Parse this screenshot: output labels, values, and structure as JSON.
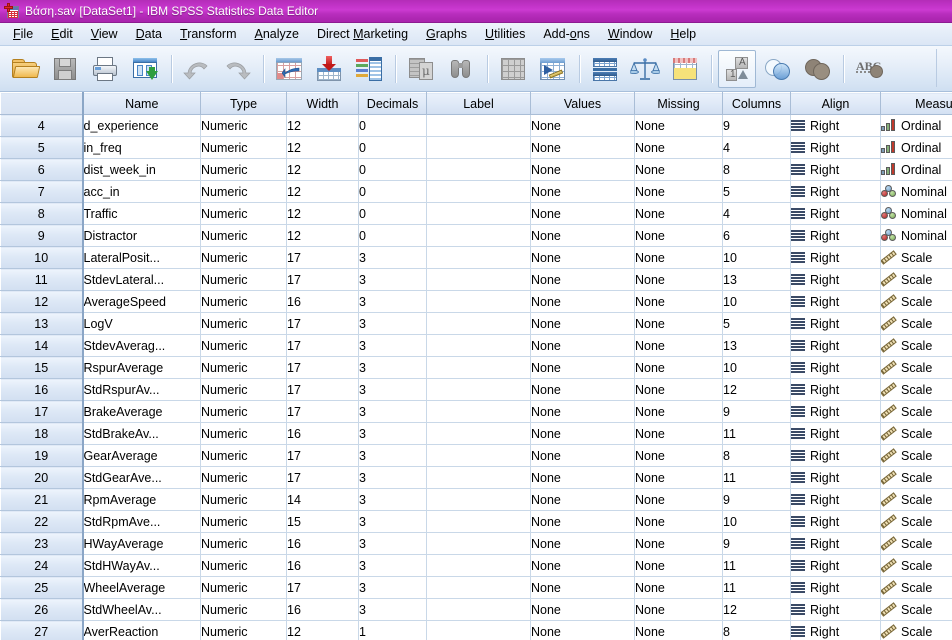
{
  "window": {
    "title": "Βάση.sav [DataSet1] - IBM SPSS Statistics Data Editor",
    "icon": "spss-data-editor-icon",
    "titlebar_color": "#c334c9"
  },
  "menu": {
    "items": [
      {
        "label": "File",
        "accel": "F"
      },
      {
        "label": "Edit",
        "accel": "E"
      },
      {
        "label": "View",
        "accel": "V"
      },
      {
        "label": "Data",
        "accel": "D"
      },
      {
        "label": "Transform",
        "accel": "T"
      },
      {
        "label": "Analyze",
        "accel": "A"
      },
      {
        "label": "Direct Marketing",
        "accel": "M"
      },
      {
        "label": "Graphs",
        "accel": "G"
      },
      {
        "label": "Utilities",
        "accel": "U"
      },
      {
        "label": "Add-ons",
        "accel": "o"
      },
      {
        "label": "Window",
        "accel": "W"
      },
      {
        "label": "Help",
        "accel": "H"
      }
    ]
  },
  "toolbar": {
    "buttons": [
      {
        "name": "open-file-button",
        "icon": "open-folder-icon",
        "enabled": true,
        "active": false
      },
      {
        "name": "save-file-button",
        "icon": "floppy-disk-icon",
        "enabled": false,
        "active": false
      },
      {
        "name": "print-button",
        "icon": "printer-icon",
        "enabled": true,
        "active": false
      },
      {
        "name": "recall-dialogs-button",
        "icon": "recall-dialogs-icon",
        "enabled": true,
        "active": false
      },
      {
        "name": "undo-button",
        "icon": "undo-arrow-icon",
        "enabled": false,
        "active": false
      },
      {
        "name": "redo-button",
        "icon": "redo-arrow-icon",
        "enabled": false,
        "active": false
      },
      {
        "name": "goto-case-button",
        "icon": "goto-case-icon",
        "enabled": true,
        "active": false
      },
      {
        "name": "goto-variable-button",
        "icon": "goto-variable-icon",
        "enabled": true,
        "active": false
      },
      {
        "name": "variables-button",
        "icon": "variables-list-icon",
        "enabled": true,
        "active": false
      },
      {
        "name": "run-descriptives-button",
        "icon": "descriptives-icon",
        "enabled": false,
        "active": false
      },
      {
        "name": "find-button",
        "icon": "binoculars-icon",
        "enabled": false,
        "active": false
      },
      {
        "name": "insert-case-button",
        "icon": "insert-case-icon",
        "enabled": false,
        "active": false
      },
      {
        "name": "insert-variable-button",
        "icon": "insert-variable-icon",
        "enabled": true,
        "active": false
      },
      {
        "name": "split-file-button",
        "icon": "split-file-icon",
        "enabled": true,
        "active": false
      },
      {
        "name": "weight-cases-button",
        "icon": "balance-scale-icon",
        "enabled": true,
        "active": false
      },
      {
        "name": "select-cases-button",
        "icon": "select-cases-icon",
        "enabled": true,
        "active": false
      },
      {
        "name": "value-labels-button",
        "icon": "value-labels-icon",
        "enabled": true,
        "active": true
      },
      {
        "name": "use-sets-button",
        "icon": "use-sets-venn-icon",
        "enabled": true,
        "active": false
      },
      {
        "name": "show-all-variables-button",
        "icon": "show-all-variables-icon",
        "enabled": false,
        "active": false
      },
      {
        "name": "spell-check-button",
        "icon": "spell-check-abc-icon",
        "enabled": false,
        "active": false
      }
    ]
  },
  "grid": {
    "columns": [
      "Name",
      "Type",
      "Width",
      "Decimals",
      "Label",
      "Values",
      "Missing",
      "Columns",
      "Align",
      "Measure"
    ],
    "rows": [
      {
        "n": "4",
        "name": "d_experience",
        "type": "Numeric",
        "width": "12",
        "decimals": "0",
        "label": "",
        "values": "None",
        "missing": "None",
        "columns": "9",
        "align": "Right",
        "measure": "Ordinal"
      },
      {
        "n": "5",
        "name": "in_freq",
        "type": "Numeric",
        "width": "12",
        "decimals": "0",
        "label": "",
        "values": "None",
        "missing": "None",
        "columns": "4",
        "align": "Right",
        "measure": "Ordinal"
      },
      {
        "n": "6",
        "name": "dist_week_in",
        "type": "Numeric",
        "width": "12",
        "decimals": "0",
        "label": "",
        "values": "None",
        "missing": "None",
        "columns": "8",
        "align": "Right",
        "measure": "Ordinal"
      },
      {
        "n": "7",
        "name": "acc_in",
        "type": "Numeric",
        "width": "12",
        "decimals": "0",
        "label": "",
        "values": "None",
        "missing": "None",
        "columns": "5",
        "align": "Right",
        "measure": "Nominal"
      },
      {
        "n": "8",
        "name": "Traffic",
        "type": "Numeric",
        "width": "12",
        "decimals": "0",
        "label": "",
        "values": "None",
        "missing": "None",
        "columns": "4",
        "align": "Right",
        "measure": "Nominal"
      },
      {
        "n": "9",
        "name": "Distractor",
        "type": "Numeric",
        "width": "12",
        "decimals": "0",
        "label": "",
        "values": "None",
        "missing": "None",
        "columns": "6",
        "align": "Right",
        "measure": "Nominal"
      },
      {
        "n": "10",
        "name": "LateralPosit...",
        "type": "Numeric",
        "width": "17",
        "decimals": "3",
        "label": "",
        "values": "None",
        "missing": "None",
        "columns": "10",
        "align": "Right",
        "measure": "Scale"
      },
      {
        "n": "11",
        "name": "StdevLateral...",
        "type": "Numeric",
        "width": "17",
        "decimals": "3",
        "label": "",
        "values": "None",
        "missing": "None",
        "columns": "13",
        "align": "Right",
        "measure": "Scale"
      },
      {
        "n": "12",
        "name": "AverageSpeed",
        "type": "Numeric",
        "width": "16",
        "decimals": "3",
        "label": "",
        "values": "None",
        "missing": "None",
        "columns": "10",
        "align": "Right",
        "measure": "Scale"
      },
      {
        "n": "13",
        "name": "LogV",
        "type": "Numeric",
        "width": "17",
        "decimals": "3",
        "label": "",
        "values": "None",
        "missing": "None",
        "columns": "5",
        "align": "Right",
        "measure": "Scale"
      },
      {
        "n": "14",
        "name": "StdevAverag...",
        "type": "Numeric",
        "width": "17",
        "decimals": "3",
        "label": "",
        "values": "None",
        "missing": "None",
        "columns": "13",
        "align": "Right",
        "measure": "Scale"
      },
      {
        "n": "15",
        "name": "RspurAverage",
        "type": "Numeric",
        "width": "17",
        "decimals": "3",
        "label": "",
        "values": "None",
        "missing": "None",
        "columns": "10",
        "align": "Right",
        "measure": "Scale"
      },
      {
        "n": "16",
        "name": "StdRspurAv...",
        "type": "Numeric",
        "width": "17",
        "decimals": "3",
        "label": "",
        "values": "None",
        "missing": "None",
        "columns": "12",
        "align": "Right",
        "measure": "Scale"
      },
      {
        "n": "17",
        "name": "BrakeAverage",
        "type": "Numeric",
        "width": "17",
        "decimals": "3",
        "label": "",
        "values": "None",
        "missing": "None",
        "columns": "9",
        "align": "Right",
        "measure": "Scale"
      },
      {
        "n": "18",
        "name": "StdBrakeAv...",
        "type": "Numeric",
        "width": "16",
        "decimals": "3",
        "label": "",
        "values": "None",
        "missing": "None",
        "columns": "11",
        "align": "Right",
        "measure": "Scale"
      },
      {
        "n": "19",
        "name": "GearAverage",
        "type": "Numeric",
        "width": "17",
        "decimals": "3",
        "label": "",
        "values": "None",
        "missing": "None",
        "columns": "8",
        "align": "Right",
        "measure": "Scale"
      },
      {
        "n": "20",
        "name": "StdGearAve...",
        "type": "Numeric",
        "width": "17",
        "decimals": "3",
        "label": "",
        "values": "None",
        "missing": "None",
        "columns": "11",
        "align": "Right",
        "measure": "Scale"
      },
      {
        "n": "21",
        "name": "RpmAverage",
        "type": "Numeric",
        "width": "14",
        "decimals": "3",
        "label": "",
        "values": "None",
        "missing": "None",
        "columns": "9",
        "align": "Right",
        "measure": "Scale"
      },
      {
        "n": "22",
        "name": "StdRpmAve...",
        "type": "Numeric",
        "width": "15",
        "decimals": "3",
        "label": "",
        "values": "None",
        "missing": "None",
        "columns": "10",
        "align": "Right",
        "measure": "Scale"
      },
      {
        "n": "23",
        "name": "HWayAverage",
        "type": "Numeric",
        "width": "16",
        "decimals": "3",
        "label": "",
        "values": "None",
        "missing": "None",
        "columns": "9",
        "align": "Right",
        "measure": "Scale"
      },
      {
        "n": "24",
        "name": "StdHWayAv...",
        "type": "Numeric",
        "width": "16",
        "decimals": "3",
        "label": "",
        "values": "None",
        "missing": "None",
        "columns": "11",
        "align": "Right",
        "measure": "Scale"
      },
      {
        "n": "25",
        "name": "WheelAverage",
        "type": "Numeric",
        "width": "17",
        "decimals": "3",
        "label": "",
        "values": "None",
        "missing": "None",
        "columns": "11",
        "align": "Right",
        "measure": "Scale"
      },
      {
        "n": "26",
        "name": "StdWheelAv...",
        "type": "Numeric",
        "width": "16",
        "decimals": "3",
        "label": "",
        "values": "None",
        "missing": "None",
        "columns": "12",
        "align": "Right",
        "measure": "Scale"
      },
      {
        "n": "27",
        "name": "AverReaction",
        "type": "Numeric",
        "width": "12",
        "decimals": "1",
        "label": "",
        "values": "None",
        "missing": "None",
        "columns": "8",
        "align": "Right",
        "measure": "Scale"
      }
    ]
  }
}
